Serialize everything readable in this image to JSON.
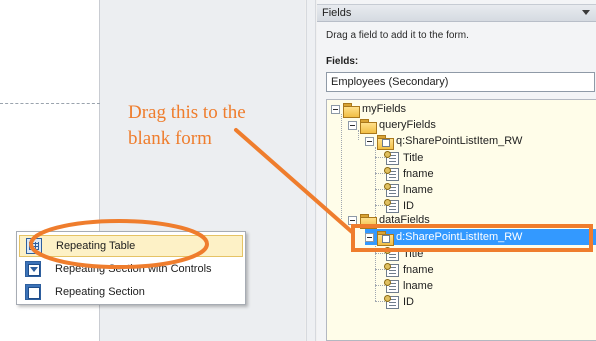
{
  "canvas": {},
  "context_menu": {
    "items": [
      {
        "label": "Repeating Table",
        "icon": "repeating-table-icon",
        "highlighted": true
      },
      {
        "label": "Repeating Section with Controls",
        "icon": "repeating-section-controls-icon",
        "highlighted": false
      },
      {
        "label": "Repeating Section",
        "icon": "repeating-section-icon",
        "highlighted": false
      }
    ]
  },
  "annotation": {
    "line1": "Drag this to the",
    "line2": "blank form",
    "color": "#ef7d2d"
  },
  "fields_pane": {
    "title": "Fields",
    "instructions": "Drag a field to add it to the form.",
    "fields_label": "Fields:",
    "datasource_value": "Employees (Secondary)",
    "tree": {
      "root": "myFields",
      "query_fields": "queryFields",
      "query_group": "q:SharePointListItem_RW",
      "query_items": [
        "Title",
        "fname",
        "lname",
        "ID"
      ],
      "data_fields": "dataFields",
      "data_group": "d:SharePointListItem_RW",
      "data_items": [
        "Title",
        "fname",
        "lname",
        "ID"
      ]
    }
  },
  "colors": {
    "accent_orange": "#ef7d2d",
    "selection_blue": "#3399ff",
    "tree_background": "#fffde9"
  }
}
